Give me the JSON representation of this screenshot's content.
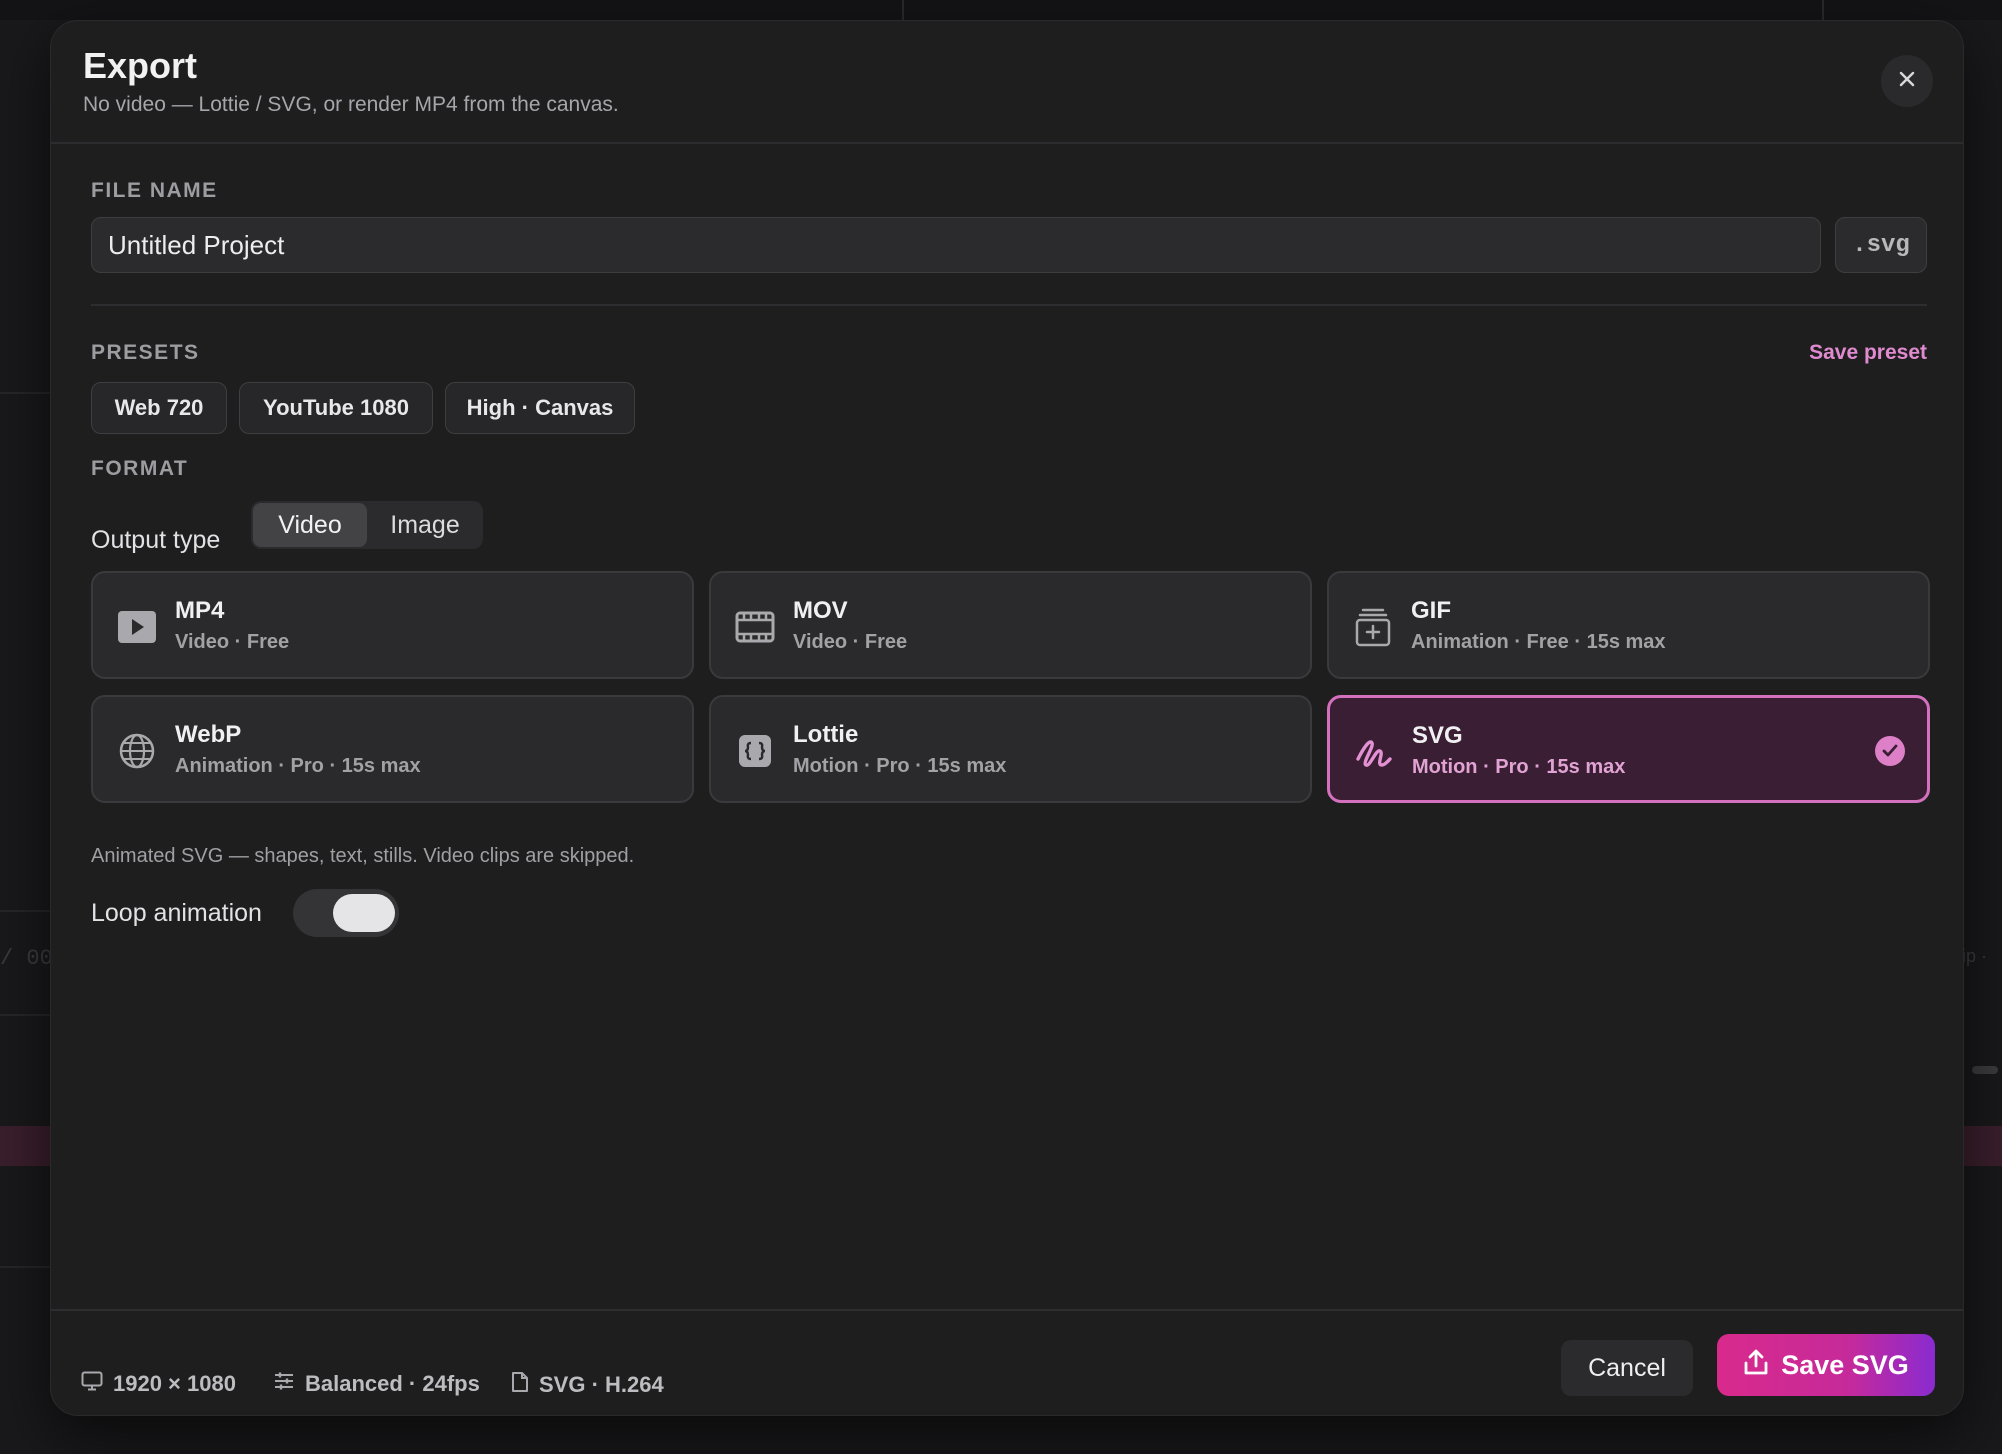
{
  "backdrop": {
    "timecode_fragment": "/ 00",
    "right_fragment": "ip ·"
  },
  "dialog": {
    "title": "Export",
    "subtitle": "No video — Lottie / SVG, or render MP4 from the canvas.",
    "close_icon": "close-icon"
  },
  "file_name": {
    "label": "FILE NAME",
    "value": "Untitled Project",
    "extension": ".svg"
  },
  "presets": {
    "label": "PRESETS",
    "save_label": "Save preset",
    "items": [
      {
        "label": "Web 720"
      },
      {
        "label": "YouTube 1080"
      },
      {
        "label": "High · Canvas"
      }
    ]
  },
  "format": {
    "label": "FORMAT",
    "output_type_label": "Output type",
    "output_types": [
      {
        "label": "Video",
        "active": true
      },
      {
        "label": "Image",
        "active": false
      }
    ],
    "cards": [
      {
        "name": "MP4",
        "sub": "Video · Free",
        "icon": "play-icon",
        "selected": false
      },
      {
        "name": "MOV",
        "sub": "Video · Free",
        "icon": "film-icon",
        "selected": false
      },
      {
        "name": "GIF",
        "sub": "Animation · Free · 15s max",
        "icon": "gif-stack-icon",
        "selected": false
      },
      {
        "name": "WebP",
        "sub": "Animation · Pro · 15s max",
        "icon": "globe-icon",
        "selected": false
      },
      {
        "name": "Lottie",
        "sub": "Motion · Pro · 15s max",
        "icon": "braces-icon",
        "selected": false
      },
      {
        "name": "SVG",
        "sub": "Motion · Pro · 15s max",
        "icon": "squiggle-icon",
        "selected": true
      }
    ],
    "note": "Animated SVG — shapes, text, stills. Video clips are skipped."
  },
  "loop": {
    "label": "Loop animation",
    "enabled": true
  },
  "footer": {
    "resolution": "1920 × 1080",
    "quality": "Balanced · 24fps",
    "codec": "SVG · H.264",
    "cancel_label": "Cancel",
    "save_label": "Save SVG"
  },
  "colors": {
    "accent": "#d471be",
    "save_gradient_start": "#d92a8c",
    "save_gradient_end": "#8a2bd0"
  }
}
